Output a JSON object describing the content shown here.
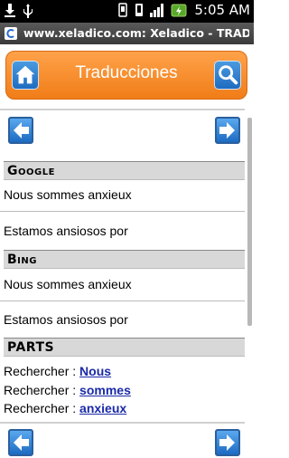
{
  "status_bar": {
    "time": "5:05 AM",
    "icons": [
      "download-icon",
      "usb-icon",
      "vibrate-icon",
      "signal-icon",
      "battery-icon"
    ]
  },
  "browser": {
    "page_title": "www.xeladico.com: Xeladico - TRADU..."
  },
  "header": {
    "title": "Traducciones",
    "left_icon": "home-icon",
    "right_icon": "search-icon"
  },
  "sections": [
    {
      "heading": "Google",
      "source_text": "Nous sommes anxieux",
      "translation": "Estamos ansiosos por"
    },
    {
      "heading": "Bing",
      "source_text": "Nous sommes anxieux",
      "translation": "Estamos ansiosos por"
    }
  ],
  "parts": {
    "heading": "PARTS",
    "prefix": "Rechercher : ",
    "words": [
      "Nous",
      "sommes",
      "anxieux"
    ]
  },
  "colors": {
    "header_orange": "#f07d18",
    "button_blue": "#1f6cc0",
    "link_blue": "#1a2aa8"
  }
}
